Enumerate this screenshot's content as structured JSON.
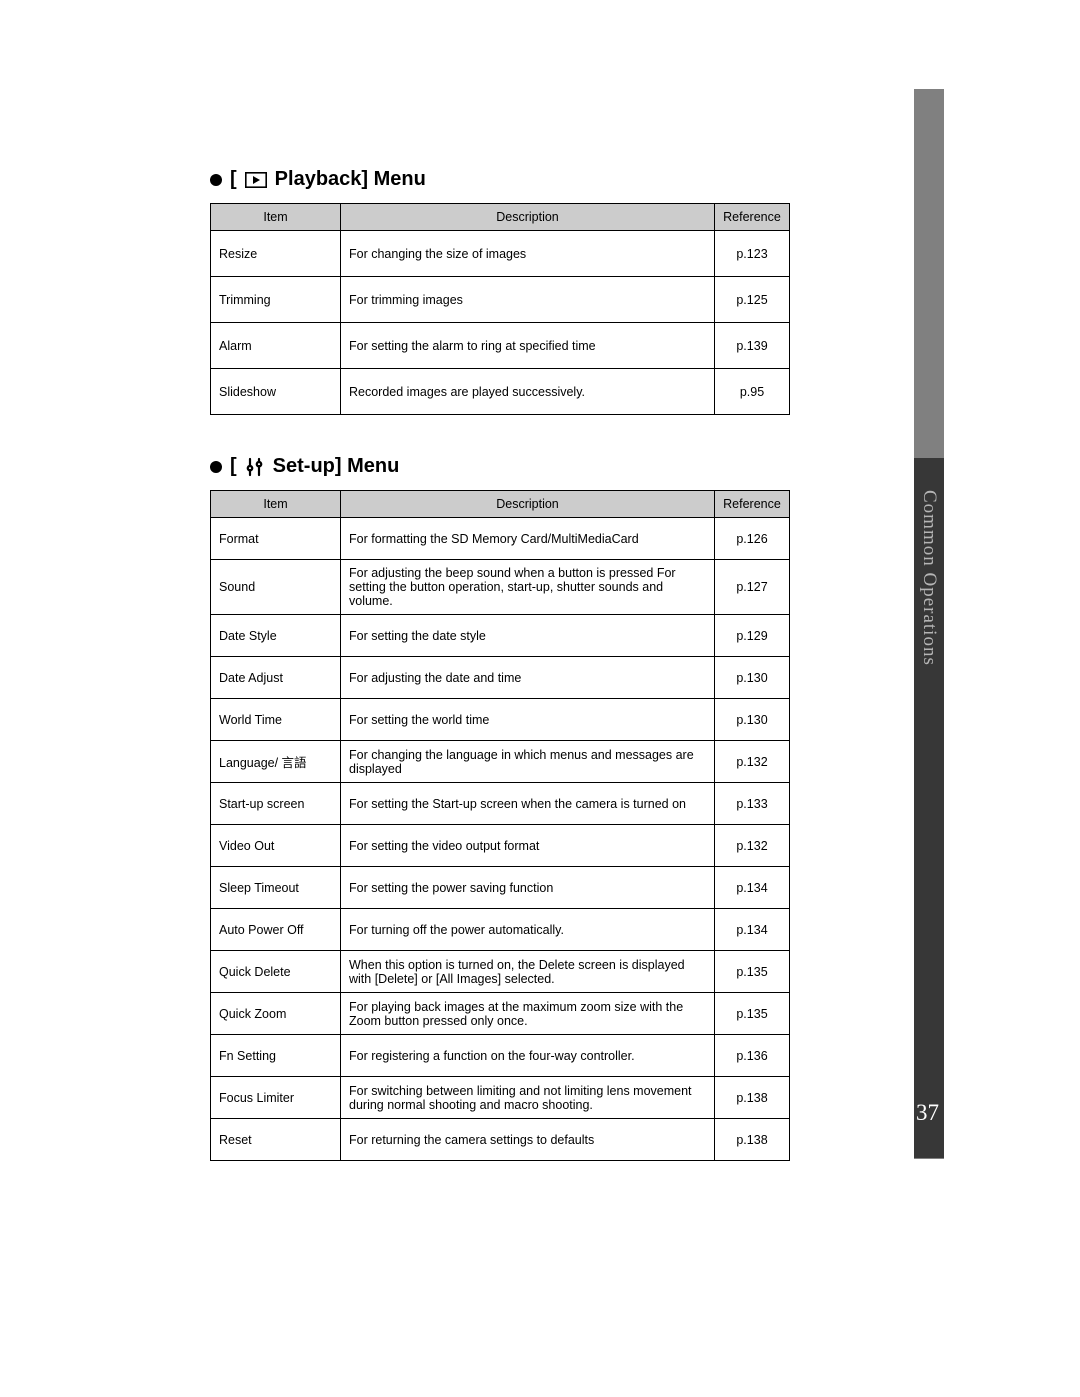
{
  "sideLabel": "Common Operations",
  "pageNumber": "37",
  "playback": {
    "title": "Playback] Menu",
    "headers": {
      "item": "Item",
      "description": "Description",
      "reference": "Reference"
    },
    "rows": [
      {
        "item": "Resize",
        "description": "For changing the size of images",
        "reference": "p.123"
      },
      {
        "item": "Trimming",
        "description": "For trimming images",
        "reference": "p.125"
      },
      {
        "item": "Alarm",
        "description": "For setting the alarm to ring at specified time",
        "reference": "p.139"
      },
      {
        "item": "Slideshow",
        "description": "Recorded images are played successively.",
        "reference": "p.95"
      }
    ]
  },
  "setup": {
    "title": "Set-up] Menu",
    "headers": {
      "item": "Item",
      "description": "Description",
      "reference": "Reference"
    },
    "rows": [
      {
        "item": "Format",
        "description": "For formatting the SD Memory Card/MultiMediaCard",
        "reference": "p.126"
      },
      {
        "item": "Sound",
        "description": "For adjusting the beep sound when a button is pressed\nFor setting the button operation, start-up, shutter sounds and volume.",
        "reference": "p.127"
      },
      {
        "item": "Date Style",
        "description": "For setting the date style",
        "reference": "p.129"
      },
      {
        "item": "Date Adjust",
        "description": "For adjusting the date and time",
        "reference": "p.130"
      },
      {
        "item": "World Time",
        "description": "For setting the world time",
        "reference": "p.130"
      },
      {
        "item": "Language/ 言語",
        "description": "For changing the language in which menus and messages are displayed",
        "reference": "p.132"
      },
      {
        "item": "Start-up screen",
        "description": "For setting the Start-up screen when the camera is turned on",
        "reference": "p.133"
      },
      {
        "item": "Video Out",
        "description": "For setting the video output format",
        "reference": "p.132"
      },
      {
        "item": "Sleep Timeout",
        "description": "For setting the power saving function",
        "reference": "p.134"
      },
      {
        "item": "Auto Power Off",
        "description": "For turning off the power automatically.",
        "reference": "p.134"
      },
      {
        "item": "Quick Delete",
        "description": "When this option is turned on, the Delete screen is displayed with [Delete] or [All Images] selected.",
        "reference": "p.135"
      },
      {
        "item": "Quick Zoom",
        "description": "For playing back images at the maximum zoom size with the Zoom button pressed only once.",
        "reference": "p.135"
      },
      {
        "item": "Fn Setting",
        "description": "For registering a function on the four-way controller.",
        "reference": "p.136"
      },
      {
        "item": "Focus Limiter",
        "description": "For switching between limiting and not limiting lens movement during normal shooting and macro shooting.",
        "reference": "p.138"
      },
      {
        "item": "Reset",
        "description": "For returning the camera settings to defaults",
        "reference": "p.138"
      }
    ]
  }
}
